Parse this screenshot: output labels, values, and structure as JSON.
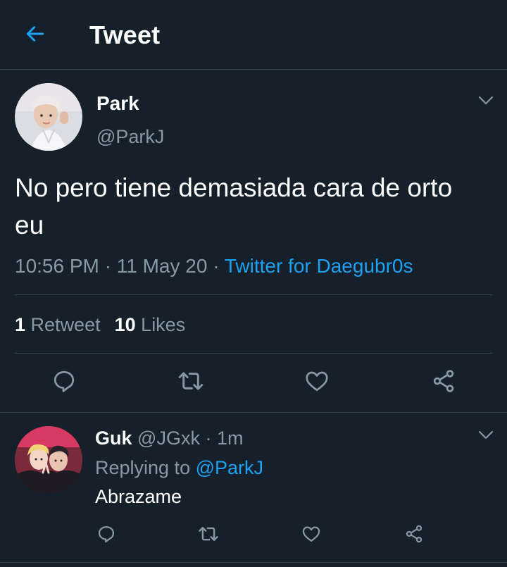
{
  "header": {
    "title": "Tweet",
    "back_icon": "arrow-left-icon",
    "accent_color": "#1da1f2"
  },
  "tweet": {
    "author_name": "Park",
    "author_handle": "@ParkJ",
    "text": "No pero tiene demasiada cara de orto eu",
    "time": "10:56 PM",
    "date": "11 May 20",
    "separator": "·",
    "source": "Twitter for Daegubr0s",
    "retweets_count": "1",
    "retweets_label": "Retweet",
    "likes_count": "10",
    "likes_label": "Likes",
    "actions": [
      "reply-icon",
      "retweet-icon",
      "like-icon",
      "share-icon"
    ]
  },
  "reply": {
    "author_name": "Guk",
    "author_handle": "@JGxk",
    "separator": "·",
    "time": "1m",
    "replying_prefix": "Replying to",
    "replying_to": "@ParkJ",
    "text": "Abrazame",
    "actions": [
      "reply-icon",
      "retweet-icon",
      "like-icon",
      "share-icon"
    ]
  },
  "colors": {
    "background": "#15202b",
    "divider": "#38444d",
    "secondary_text": "#8899a6",
    "link": "#1da1f2"
  }
}
